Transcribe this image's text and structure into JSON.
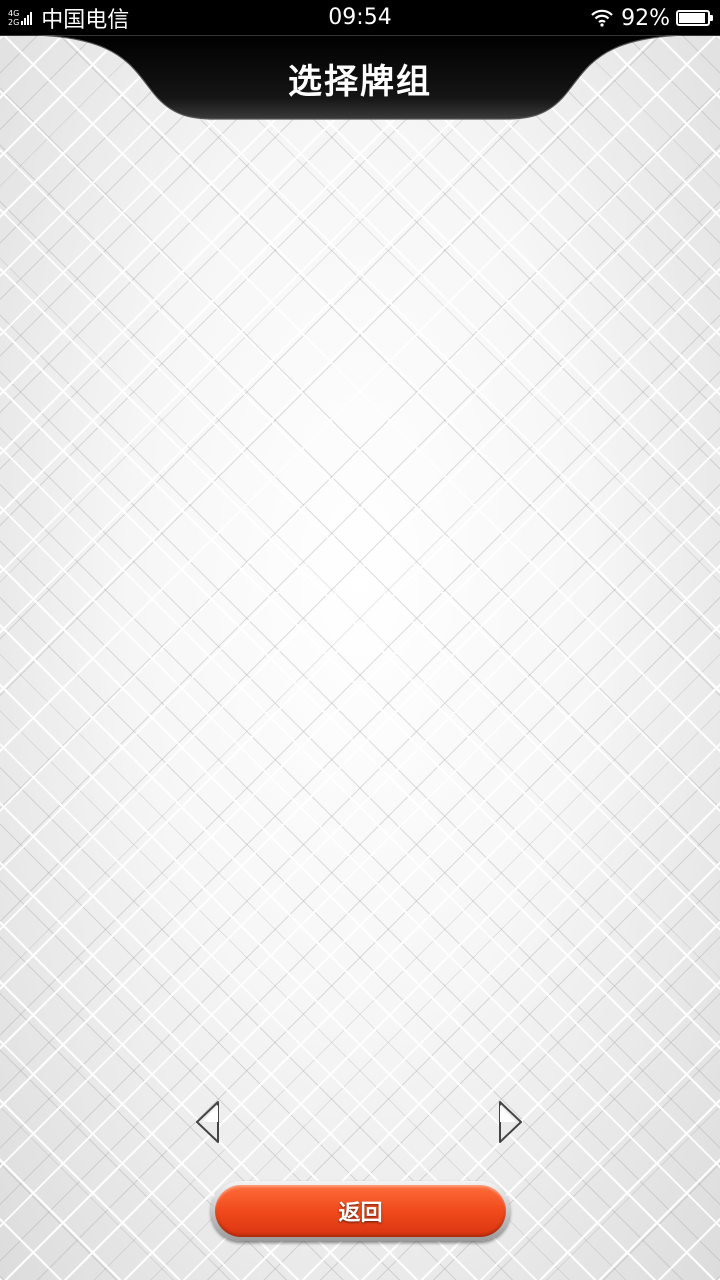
{
  "status_bar": {
    "network_top": "4G",
    "network_bottom": "2G",
    "carrier": "中国电信",
    "time": "09:54",
    "battery_percent": "92%",
    "battery_level": 0.92,
    "icons": [
      "signal-icon",
      "wifi-icon",
      "battery-icon"
    ]
  },
  "header": {
    "title": "选择牌组"
  },
  "navigation": {
    "prev_icon": "arrow-left-icon",
    "next_icon": "arrow-right-icon"
  },
  "footer": {
    "back_label": "返回"
  },
  "colors": {
    "header_bg": "#000000",
    "back_button": "#f04a1c",
    "background": "#eeeeee"
  }
}
